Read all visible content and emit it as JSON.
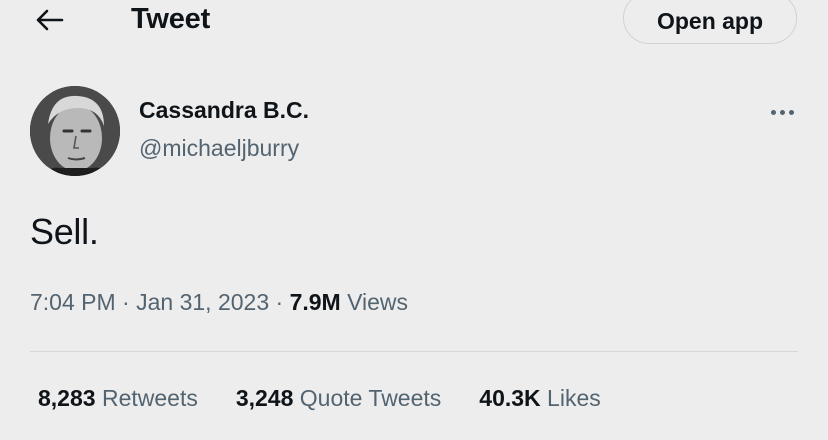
{
  "header": {
    "back_icon": "arrow-left-icon",
    "title": "Tweet",
    "open_app_label": "Open app"
  },
  "author": {
    "display_name": "Cassandra B.C.",
    "handle": "@michaeljburry",
    "avatar": "grayscale-portrait",
    "more_icon": "more-horizontal-icon"
  },
  "tweet": {
    "text": "Sell.",
    "time": "7:04 PM",
    "date": "Jan 31, 2023",
    "separator": " · ",
    "views_count": "7.9M",
    "views_label": "Views"
  },
  "stats": [
    {
      "count": "8,283",
      "label": "Retweets"
    },
    {
      "count": "3,248",
      "label": "Quote Tweets"
    },
    {
      "count": "40.3K",
      "label": "Likes"
    }
  ],
  "colors": {
    "background": "#ededee",
    "text_primary": "#0f1419",
    "text_secondary": "#536471",
    "border": "#cfd3d6"
  }
}
